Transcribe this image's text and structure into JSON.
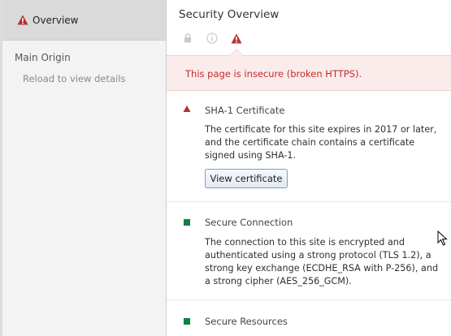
{
  "sidebar": {
    "overview_label": "Overview",
    "origin_header": "Main Origin",
    "origin_item": "Reload to view details"
  },
  "main": {
    "title": "Security Overview",
    "tabs": [
      {
        "icon": "lock-icon",
        "active": false
      },
      {
        "icon": "info-icon",
        "active": false
      },
      {
        "icon": "warning-icon",
        "active": true
      }
    ],
    "banner": "This page is insecure (broken HTTPS).",
    "sections": [
      {
        "title": "SHA-1 Certificate",
        "description": "The certificate for this site expires in 2017 or later, and the certificate chain contains a certificate signed using SHA-1.",
        "button": "View certificate",
        "status": "insecure"
      },
      {
        "title": "Secure Connection",
        "description": "The connection to this site is encrypted and authenticated using a strong protocol (TLS 1.2), a strong key exchange (ECDHE_RSA with P-256), and a strong cipher (AES_256_GCM).",
        "status": "secure"
      },
      {
        "title": "Secure Resources",
        "status": "secure"
      }
    ]
  },
  "colors": {
    "insecure": "#b8312f",
    "secure": "#0b8043",
    "banner_bg": "#fbecec",
    "banner_text": "#c62828"
  }
}
